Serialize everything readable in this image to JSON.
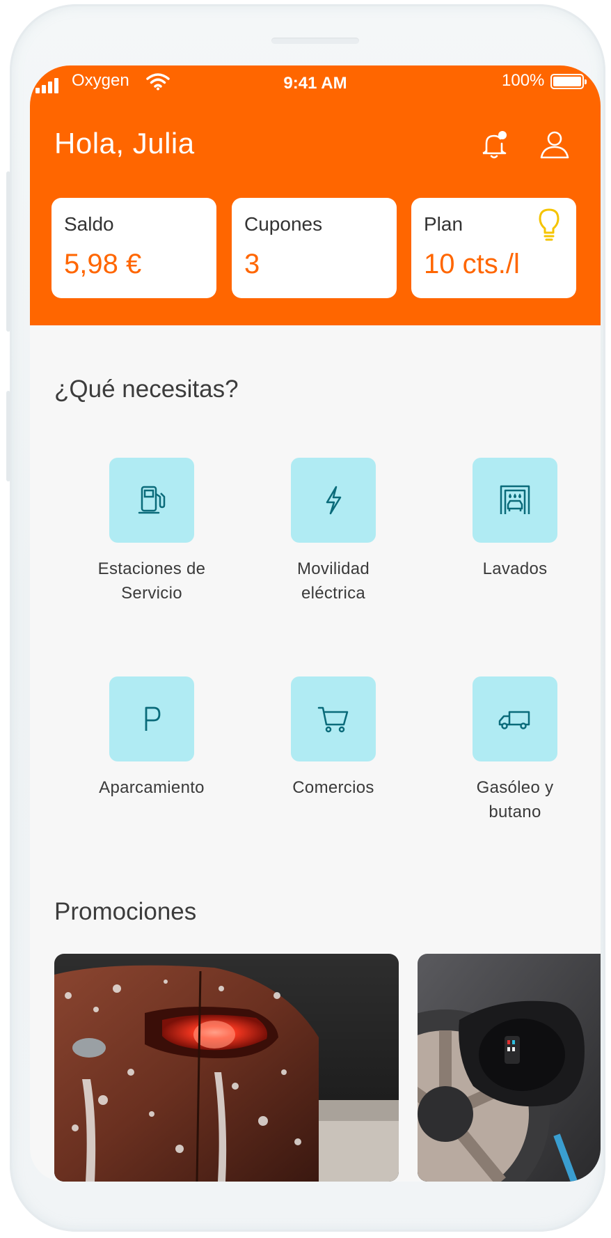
{
  "status_bar": {
    "carrier": "Oxygen",
    "time": "9:41 AM",
    "battery": "100%"
  },
  "header": {
    "greeting": "Hola, Julia",
    "icons": [
      "bell-icon",
      "user-icon"
    ],
    "notification_dot": true,
    "cards": [
      {
        "label": "Saldo",
        "value": "5,98 €"
      },
      {
        "label": "Cupones",
        "value": "3"
      },
      {
        "label": "Plan",
        "value": "10 cts./l",
        "icon": "lightbulb-icon"
      }
    ]
  },
  "services": {
    "title": "¿Qué necesitas?",
    "items": [
      {
        "line1": "Estaciones de",
        "line2": "Servicio",
        "icon": "fuel-pump-icon"
      },
      {
        "line1": "Movilidad",
        "line2": "eléctrica",
        "icon": "lightning-icon"
      },
      {
        "line1": "Lavados",
        "line2": "",
        "icon": "car-wash-icon"
      },
      {
        "line1": "Aparcamiento",
        "line2": "",
        "icon": "parking-icon"
      },
      {
        "line1": "Comercios",
        "line2": "",
        "icon": "cart-icon"
      },
      {
        "line1": "Gasóleo y",
        "line2": "butano",
        "icon": "truck-icon"
      }
    ]
  },
  "promotions": {
    "title": "Promociones",
    "items": [
      {
        "image": "car-wash-photo"
      },
      {
        "image": "ev-charging-photo"
      }
    ]
  },
  "colors": {
    "brand_orange": "#ff6600",
    "tile_cyan": "#b0ebf3",
    "icon_teal": "#0a6b7a",
    "bulb_yellow": "#f5c400"
  }
}
